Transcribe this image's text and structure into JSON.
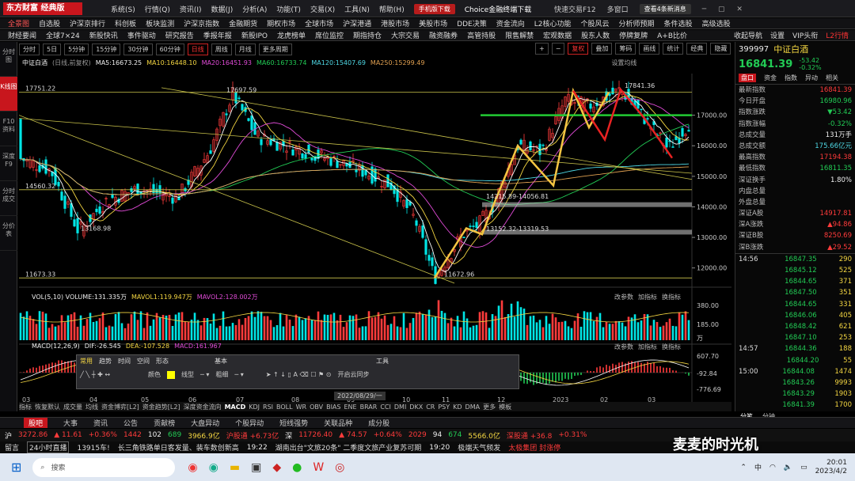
{
  "app": {
    "logo": "东方财富 经典版",
    "menu": [
      "系统(S)",
      "行情(Q)",
      "资讯(I)",
      "数据(J)",
      "分析(A)",
      "功能(T)",
      "交易(X)",
      "工具(N)",
      "帮助(H)"
    ],
    "mobile_btn": "手机版下载",
    "choice_btn": "Choice金融终端下载",
    "quick": "快速交易F12",
    "multi": "多窗口",
    "notice": "查看4条新消息"
  },
  "menu2": [
    "全景图",
    "自选股",
    "沪深京排行",
    "科创板",
    "板块监测",
    "沪深京指数",
    "金融期货",
    "期权市场",
    "全球市场",
    "沪深港通",
    "港股市场",
    "美股市场",
    "DDE决策",
    "资金流向",
    "L2核心功能",
    "个股风云",
    "分析师预期",
    "条件选股",
    "高级选股"
  ],
  "menu3": [
    "财经要闻",
    "全球7×24",
    "新股快讯",
    "事件驱动",
    "研究报告",
    "季报年报",
    "新股IPO",
    "龙虎榜单",
    "席位监控",
    "期指持仓",
    "大宗交易",
    "融资融券",
    "高管持股",
    "限售解禁",
    "宏观数据",
    "股东人数",
    "停牌复牌",
    "A+B比价"
  ],
  "menu3_right": [
    "收起导航",
    "设置",
    "VIP头衔",
    "L2行情"
  ],
  "leftstrip": [
    "分时图",
    "K线图",
    "F10资料",
    "深度F9",
    "分时成交",
    "分价表"
  ],
  "periods": [
    "分时",
    "5日",
    "5分钟",
    "15分钟",
    "30分钟",
    "60分钟",
    "日线",
    "周线",
    "月线",
    "更多周期"
  ],
  "toolbar_right": [
    "复权",
    "叠加",
    "筹码",
    "画线",
    "统计",
    "经典",
    "隐藏"
  ],
  "ma": {
    "title": "中证白酒",
    "subtitle": "(日线,前复权)",
    "ma5": "MA5:16673.25",
    "ma10": "MA10:16448.10",
    "ma20": "MA20:16451.93",
    "ma60": "MA60:16733.74",
    "ma120": "MA120:15407.69",
    "ma250": "MA250:15299.49",
    "settings": "设置均线"
  },
  "chart_labels": {
    "h1": "17751.22",
    "h2": "17697.59",
    "h3": "17841.36",
    "l1": "14560.32",
    "l2": "13168.98",
    "l3": "11673.33",
    "l4": "11672.96",
    "r1": "14215.89-14056.81",
    "r2": "13152.32-13319.53",
    "date_tip": "2022/08/29/一"
  },
  "price_axis": [
    "17000.00",
    "16000.00",
    "15000.00",
    "14000.00",
    "13000.00",
    "12000.00"
  ],
  "x_axis": [
    "03",
    "04",
    "05",
    "06",
    "07",
    "08",
    "09",
    "10",
    "11",
    "12",
    "2023",
    "02",
    "03"
  ],
  "vol": {
    "legend": "VOL(5,10) VOLUME:131.335万",
    "mavol1": "MAVOL1:119.947万",
    "mavol2": "MAVOL2:128.002万",
    "axis": [
      "380.00",
      "185.00",
      "万"
    ],
    "btns": [
      "改参数",
      "加指标",
      "换指标"
    ]
  },
  "macd": {
    "legend": "MACD(12,26,9)",
    "dif": "DIF:-26.545",
    "dea": "DEA:-107.528",
    "macd": "MACD:161.967",
    "axis": [
      "607.70",
      "-92.84",
      "-776.69"
    ]
  },
  "drawtools": {
    "tabs": [
      "常用",
      "趋势",
      "时间",
      "空间",
      "形态"
    ],
    "sect1": "基本",
    "sect2": "工具",
    "color": "颜色",
    "line": "线型",
    "width": "粗细",
    "cloud": "开启云同步"
  },
  "indicators": [
    "指标",
    "恢复默认",
    "成交量",
    "均线",
    "资金博弈[L2]",
    "资金趋势[L2]",
    "深度资金流向",
    "MACD",
    "KDJ",
    "RSI",
    "BOLL",
    "WR",
    "OBV",
    "BIAS",
    "ENE",
    "BRAR",
    "CCI",
    "DMI",
    "DKX",
    "CR",
    "PSY",
    "KD",
    "DMA",
    "更多",
    "模板"
  ],
  "quote": {
    "code": "399997",
    "name": "中证白酒",
    "price": "16841.39",
    "change": "-53.42",
    "pct": "-0.32%",
    "tabs": [
      "盘口",
      "资金",
      "指数",
      "异动",
      "相关"
    ],
    "rows": [
      [
        "最新指数",
        "16841.39",
        "red"
      ],
      [
        "今日开盘",
        "16980.96",
        "green"
      ],
      [
        "指数涨跌",
        "▼53.42",
        "green"
      ],
      [
        "指数涨幅",
        "-0.32%",
        "green"
      ],
      [
        "总成交量",
        "131万手",
        "white"
      ],
      [
        "总成交额",
        "175.66亿元",
        "cyan"
      ],
      [
        "最高指数",
        "17194.38",
        "red"
      ],
      [
        "最低指数",
        "16811.35",
        "green"
      ],
      [
        "深证换手",
        "1.80%",
        "white"
      ],
      [
        "内盘总量",
        "",
        ""
      ],
      [
        "外盘总量",
        "",
        ""
      ],
      [
        "深证A股",
        "14917.81",
        "red"
      ],
      [
        "深A涨跌",
        "▲94.86",
        "red"
      ],
      [
        "深证B股",
        "8250.69",
        "red"
      ],
      [
        "深B涨跌",
        "▲29.52",
        "red"
      ]
    ],
    "ticks": [
      [
        "14:56",
        "16847.35",
        "290"
      ],
      [
        "",
        "16845.12",
        "525"
      ],
      [
        "",
        "16844.65",
        "371"
      ],
      [
        "",
        "16847.50",
        "351"
      ],
      [
        "",
        "16844.65",
        "331"
      ],
      [
        "",
        "16846.06",
        "405"
      ],
      [
        "",
        "16848.42",
        "621"
      ],
      [
        "",
        "16847.10",
        "253"
      ],
      [
        "14:57",
        "16844.36",
        "188"
      ],
      [
        "",
        "16844.20",
        "55"
      ],
      [
        "15:00",
        "16844.08",
        "1474"
      ],
      [
        "",
        "16843.26",
        "9993"
      ],
      [
        "",
        "16843.29",
        "1903"
      ],
      [
        "",
        "16841.39",
        "1700"
      ]
    ],
    "bottom_tabs": [
      "分笔",
      "分钟"
    ]
  },
  "bottom_tabs": [
    "股吧",
    "大事",
    "资讯",
    "公告",
    "贡献榜",
    "大盘异动",
    "个股异动",
    "短线强势",
    "关联品种",
    "成分股"
  ],
  "indexbar": {
    "i1": "沪",
    "v1": "3272.86",
    "c1": "▲ 11.61",
    "p1": "+0.36%",
    "n1": "1442",
    "n2": "102",
    "n3": "689",
    "amt1": "3966.9亿",
    "hgt": "沪股通 +6.73亿",
    "i2": "深",
    "v2": "11726.40",
    "c2": "▲ 74.57",
    "p2": "+0.64%",
    "n4": "2029",
    "n5": "94",
    "n6": "674",
    "amt2": "5566.0亿",
    "sgt": "深股通 +36.8",
    "p3": "+0.31%"
  },
  "news": {
    "t0": "留言",
    "t1": "24小时直播",
    "n1": "13915车!",
    "n2": "长三角铁路单日客发量、装车数创新高",
    "time": "19:22",
    "n3": "湖南出台\"文旅20条\" 二季度文旅产业复苏可期",
    "time2": "19:20",
    "n4": "极端天气频发",
    "n5": "太极集团 封涨停",
    "watermark": "麦麦的时光机"
  },
  "taskbar": {
    "search": "搜索",
    "ime": "中",
    "time": "20:01",
    "date": "2023/4/2"
  },
  "chart_data": {
    "type": "line",
    "title": "中证白酒 (日线,前复权)",
    "x": [
      "03",
      "04",
      "05",
      "06",
      "07",
      "08",
      "09",
      "10",
      "11",
      "12",
      "2023",
      "02",
      "03"
    ],
    "series": [
      {
        "name": "MA5",
        "values": [
          16673.25
        ]
      },
      {
        "name": "MA10",
        "values": [
          16448.1
        ]
      },
      {
        "name": "MA20",
        "values": [
          16451.93
        ]
      },
      {
        "name": "MA60",
        "values": [
          16733.74
        ]
      },
      {
        "name": "MA120",
        "values": [
          15407.69
        ]
      },
      {
        "name": "MA250",
        "values": [
          15299.49
        ]
      }
    ],
    "ylim": [
      11500,
      18000
    ],
    "annotations": [
      "17751.22",
      "17697.59",
      "17841.36",
      "14560.32",
      "13168.98",
      "11673.33",
      "11672.96",
      "14215.89-14056.81",
      "13152.32-13319.53"
    ],
    "y_ticks": [
      "17000.00",
      "16000.00",
      "15000.00",
      "14000.00",
      "13000.00",
      "12000.00"
    ]
  }
}
